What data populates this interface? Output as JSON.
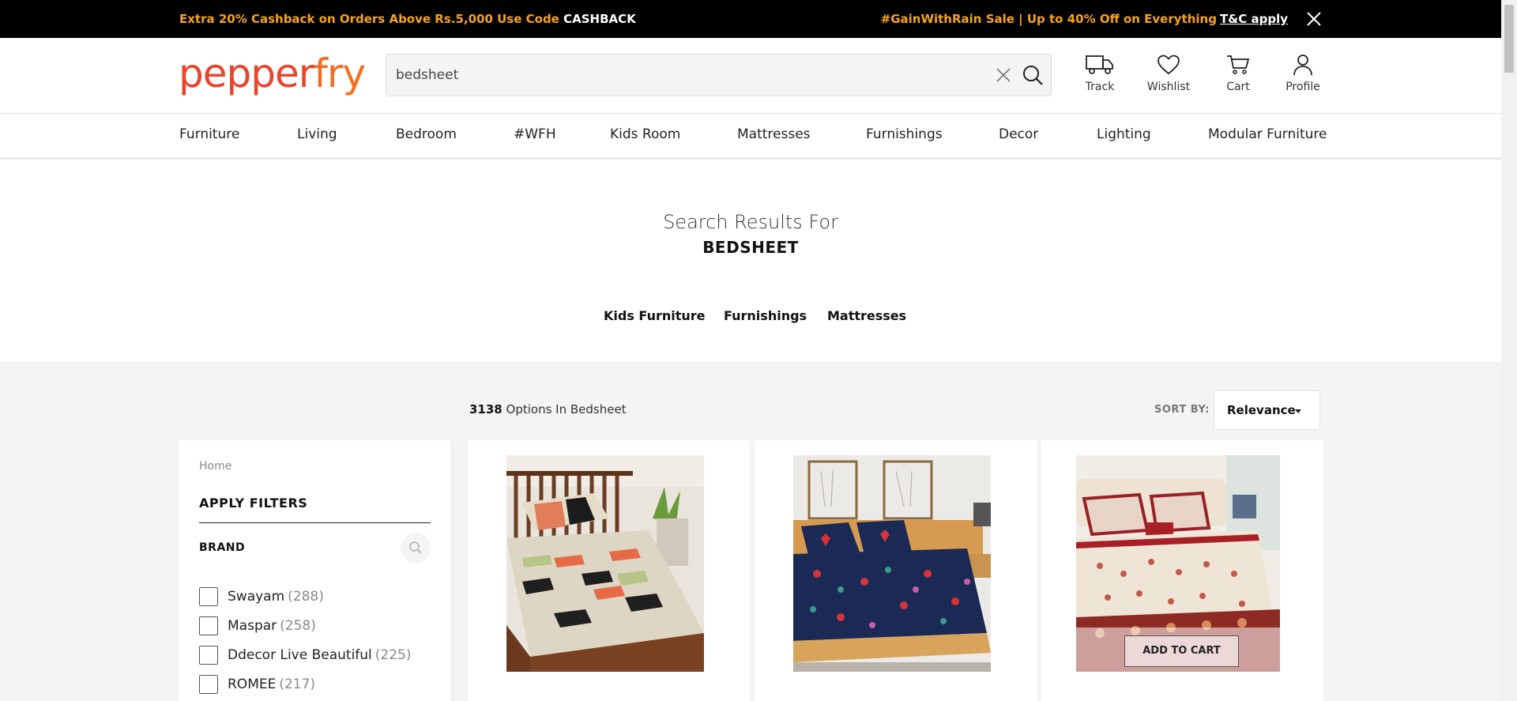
{
  "promo": {
    "left_text": "Extra 20% Cashback on Orders Above Rs.5,000 Use Code ",
    "left_code": "CASHBACK",
    "right_text": "#GainWithRain Sale | Up to 40% Off on Everything",
    "right_link": "T&C apply"
  },
  "header": {
    "logo_part1": "pepper",
    "logo_part2": "fry",
    "search_value": "bedsheet",
    "icons": {
      "track": "Track",
      "wishlist": "Wishlist",
      "cart": "Cart",
      "profile": "Profile"
    }
  },
  "nav": [
    "Furniture",
    "Living",
    "Bedroom",
    "#WFH",
    "Kids Room",
    "Mattresses",
    "Furnishings",
    "Decor",
    "Lighting",
    "Modular Furniture"
  ],
  "results": {
    "heading": "Search Results For",
    "term": "BEDSHEET",
    "categories": [
      "Kids Furniture",
      "Furnishings",
      "Mattresses"
    ]
  },
  "listing": {
    "count": "3138",
    "count_label": " Options In Bedsheet",
    "sort_label": "SORT BY:",
    "sort_value": "Relevance"
  },
  "filters": {
    "breadcrumb": "Home",
    "title": "APPLY FILTERS",
    "brand_title": "BRAND",
    "brands": [
      {
        "name": "Swayam",
        "count": "(288)"
      },
      {
        "name": "Maspar",
        "count": "(258)"
      },
      {
        "name": "Ddecor Live Beautiful",
        "count": "(225)"
      },
      {
        "name": "ROMEE",
        "count": "(217)"
      }
    ]
  },
  "products": {
    "add_to_cart": "ADD TO CART"
  },
  "colors": {
    "brand_red": "#e8452c",
    "brand_orange": "#f26f21",
    "promo_text": "#f7a31c"
  }
}
